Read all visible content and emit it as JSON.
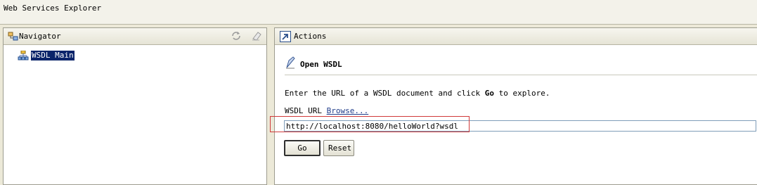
{
  "window": {
    "title": "Web Services Explorer"
  },
  "navigator": {
    "title": "Navigator",
    "tools": [
      {
        "icon": "refresh-icon"
      },
      {
        "icon": "clear-icon"
      }
    ],
    "tree": [
      {
        "label": "WSDL Main",
        "selected": true,
        "icon": "wsdl-tree-icon"
      }
    ]
  },
  "actions": {
    "title": "Actions",
    "section_title": "Open WSDL",
    "instructions_prefix": "Enter the URL of a WSDL document and click ",
    "instructions_bold": "Go",
    "instructions_suffix": " to explore.",
    "wsdl_url_label": "WSDL URL ",
    "browse_label": "Browse...",
    "url_value": "http://localhost:8080/helloWorld?wsdl",
    "go_label": "Go",
    "reset_label": "Reset"
  },
  "colors": {
    "selection": "#0a246a",
    "highlight_border": "#d03a3a",
    "background": "#ece9d8"
  }
}
